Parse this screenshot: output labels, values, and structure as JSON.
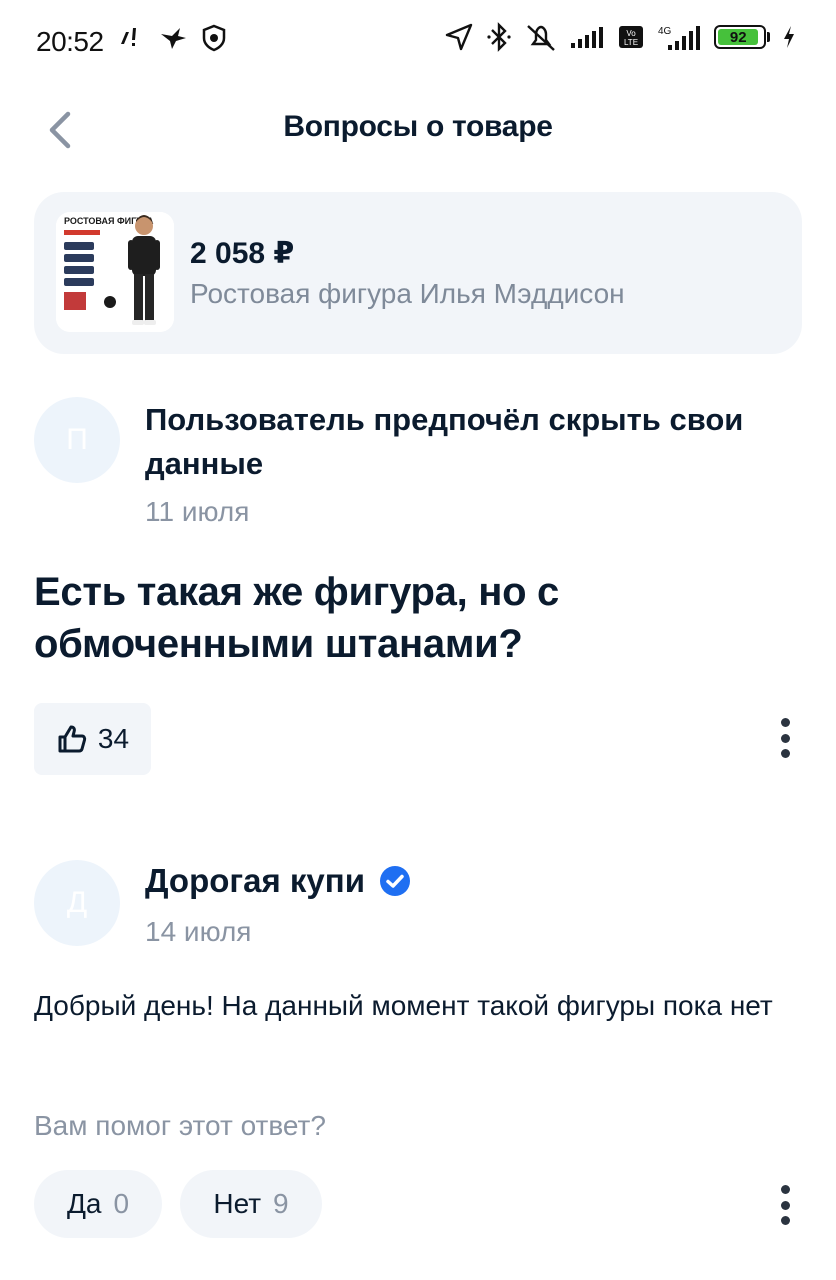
{
  "status_bar": {
    "time": "20:52",
    "battery": "92",
    "network": "4G"
  },
  "header": {
    "title": "Вопросы о товаре"
  },
  "product": {
    "price": "2 058 ₽",
    "name": "Ростовая фигура Илья Мэддисон",
    "image_caption": "РОСТОВАЯ ФИГУРА"
  },
  "question": {
    "avatar_letter": "П",
    "author": "Пользователь предпочёл скрыть свои данные",
    "date": "11 июля",
    "text": "Есть такая же фигура, но с обмоченными штанами?",
    "likes": "34"
  },
  "answer": {
    "avatar_letter": "Д",
    "author": "Дорогая купи",
    "date": "14 июля",
    "text": "Добрый день! На данный момент такой фигуры пока нет",
    "helpful_prompt": "Вам помог этот ответ?",
    "yes_label": "Да",
    "yes_count": "0",
    "no_label": "Нет",
    "no_count": "9"
  },
  "colors": {
    "accent": "#1f6ff2",
    "card_bg": "#f2f5f9",
    "muted_text": "#8a94a3"
  }
}
